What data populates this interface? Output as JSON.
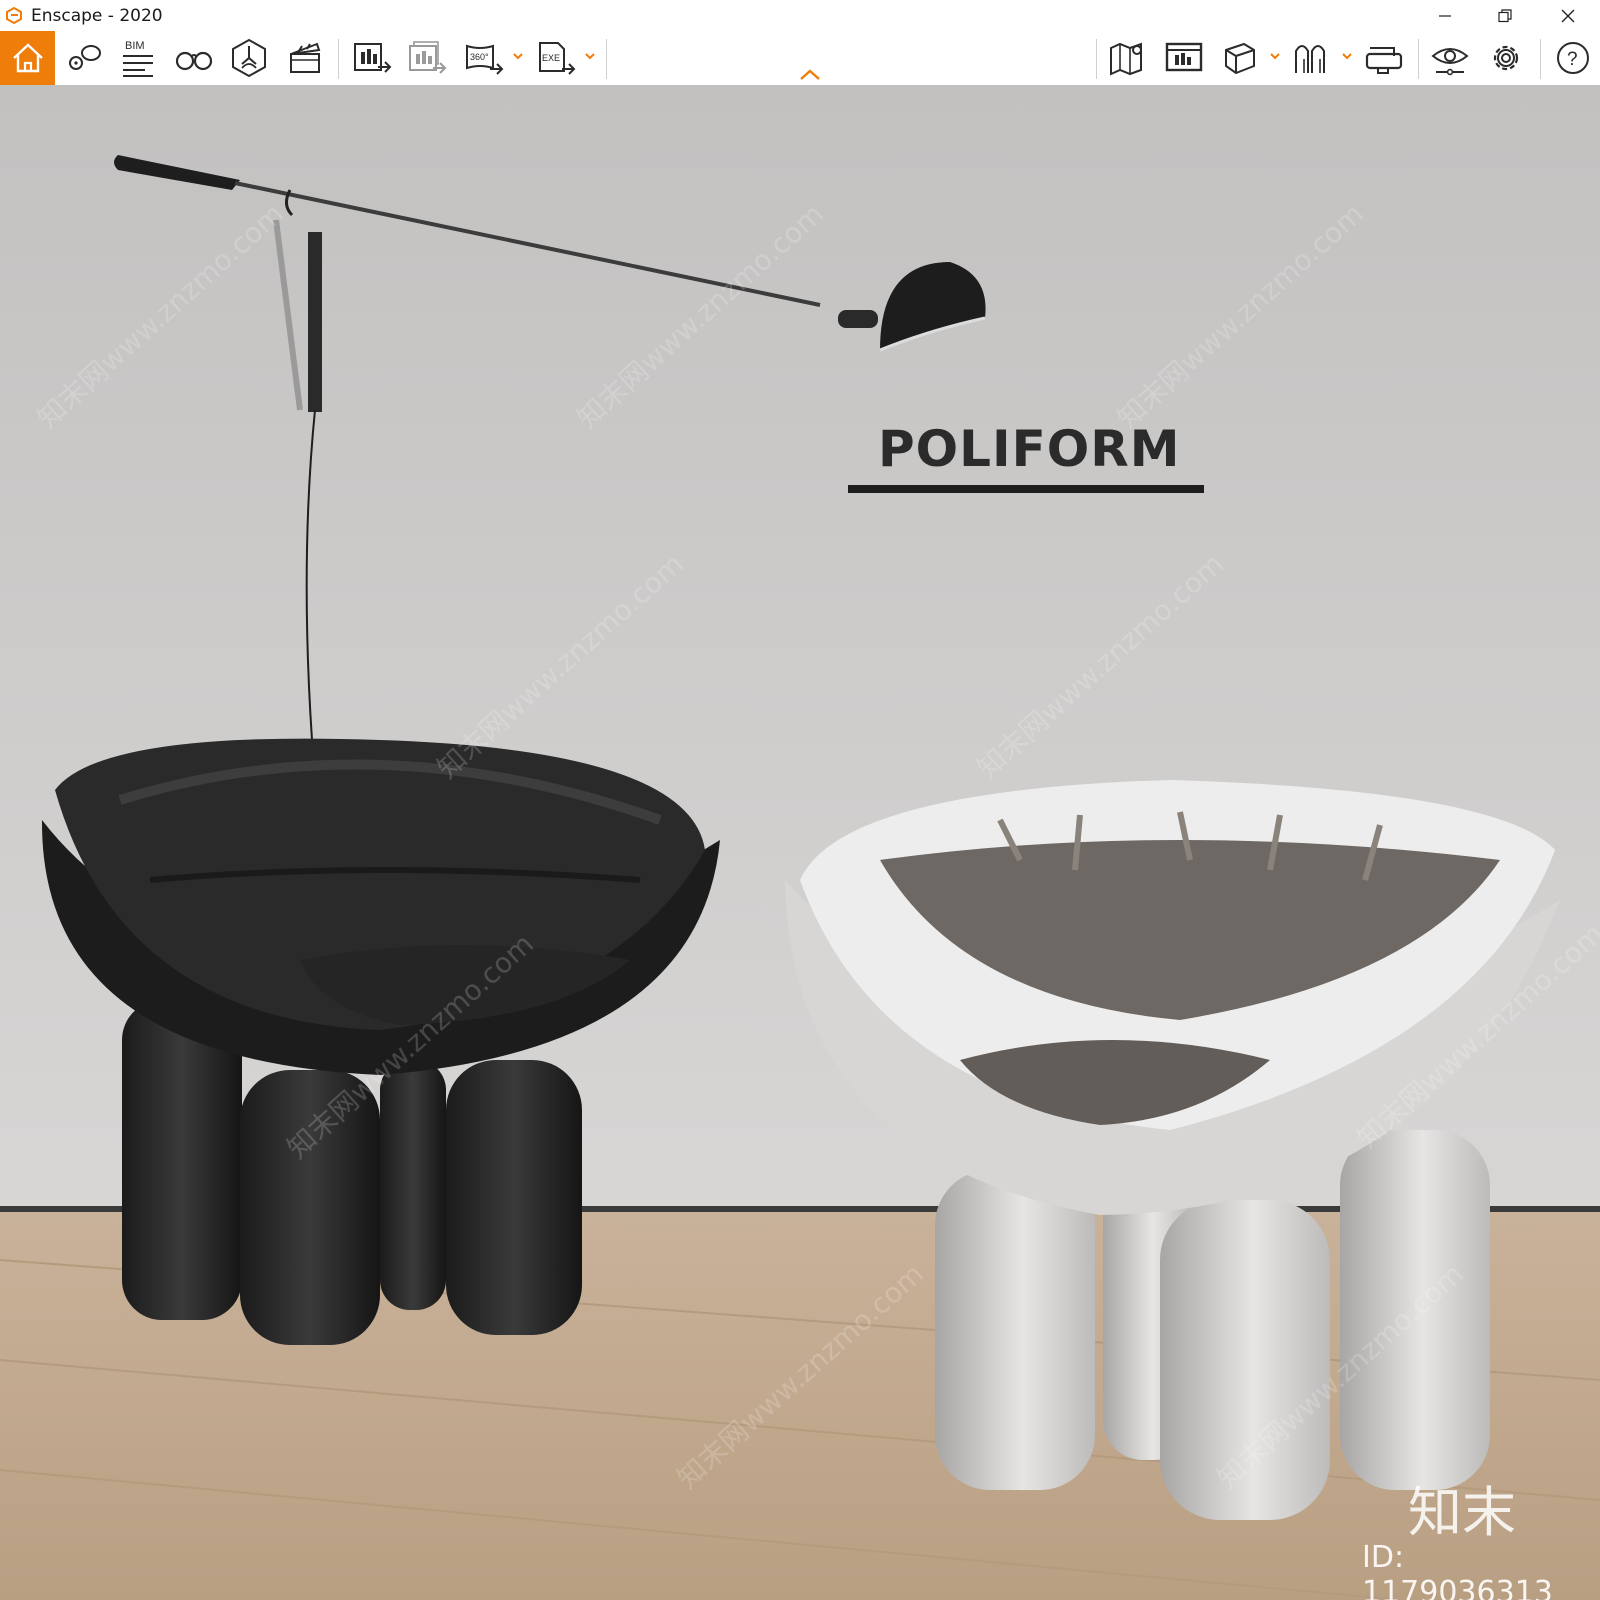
{
  "window": {
    "title": "Enscape - 2020",
    "controls": {
      "minimize": "minimize-icon",
      "restore": "restore-icon",
      "close": "close-icon"
    }
  },
  "colors": {
    "accent": "#ef7d0a",
    "toolbar_bg": "#ffffff",
    "icon": "#2b2b2b",
    "wall": "#cfcccb",
    "floor": "#c4ab8e"
  },
  "toolbar": {
    "left": [
      {
        "name": "home",
        "icon": "home-icon",
        "active": true
      },
      {
        "name": "views",
        "icon": "views-icon"
      },
      {
        "name": "bim",
        "icon": "bim-icon",
        "label": "BIM"
      },
      {
        "name": "binoculars",
        "icon": "binoculars-icon"
      },
      {
        "name": "asset-library",
        "icon": "asset-library-icon"
      },
      {
        "name": "video-editor",
        "icon": "clapperboard-icon"
      },
      {
        "name": "screenshot",
        "icon": "screenshot-export-icon"
      },
      {
        "name": "batch-render",
        "icon": "batch-render-icon"
      },
      {
        "name": "panorama",
        "icon": "panorama-icon",
        "label": "360°"
      },
      {
        "name": "exe-export",
        "icon": "exe-export-icon",
        "label": "EXE"
      }
    ],
    "right": [
      {
        "name": "map",
        "icon": "map-icon"
      },
      {
        "name": "web-export",
        "icon": "web-export-icon"
      },
      {
        "name": "cube",
        "icon": "cube-icon"
      },
      {
        "name": "collaboration",
        "icon": "people-icon"
      },
      {
        "name": "vr-headset",
        "icon": "vr-headset-icon"
      },
      {
        "name": "visual-settings",
        "icon": "eye-icon"
      },
      {
        "name": "settings",
        "icon": "gear-icon"
      },
      {
        "name": "help",
        "icon": "help-icon",
        "label": "?"
      }
    ],
    "collapse_icon": "chevron-up-icon"
  },
  "viewport": {
    "brand_text": "POLIFORM",
    "watermark_chars": "知末",
    "watermark_id": "ID: 1179036313",
    "tiled_watermark": "知末网www.znzmo.com"
  }
}
